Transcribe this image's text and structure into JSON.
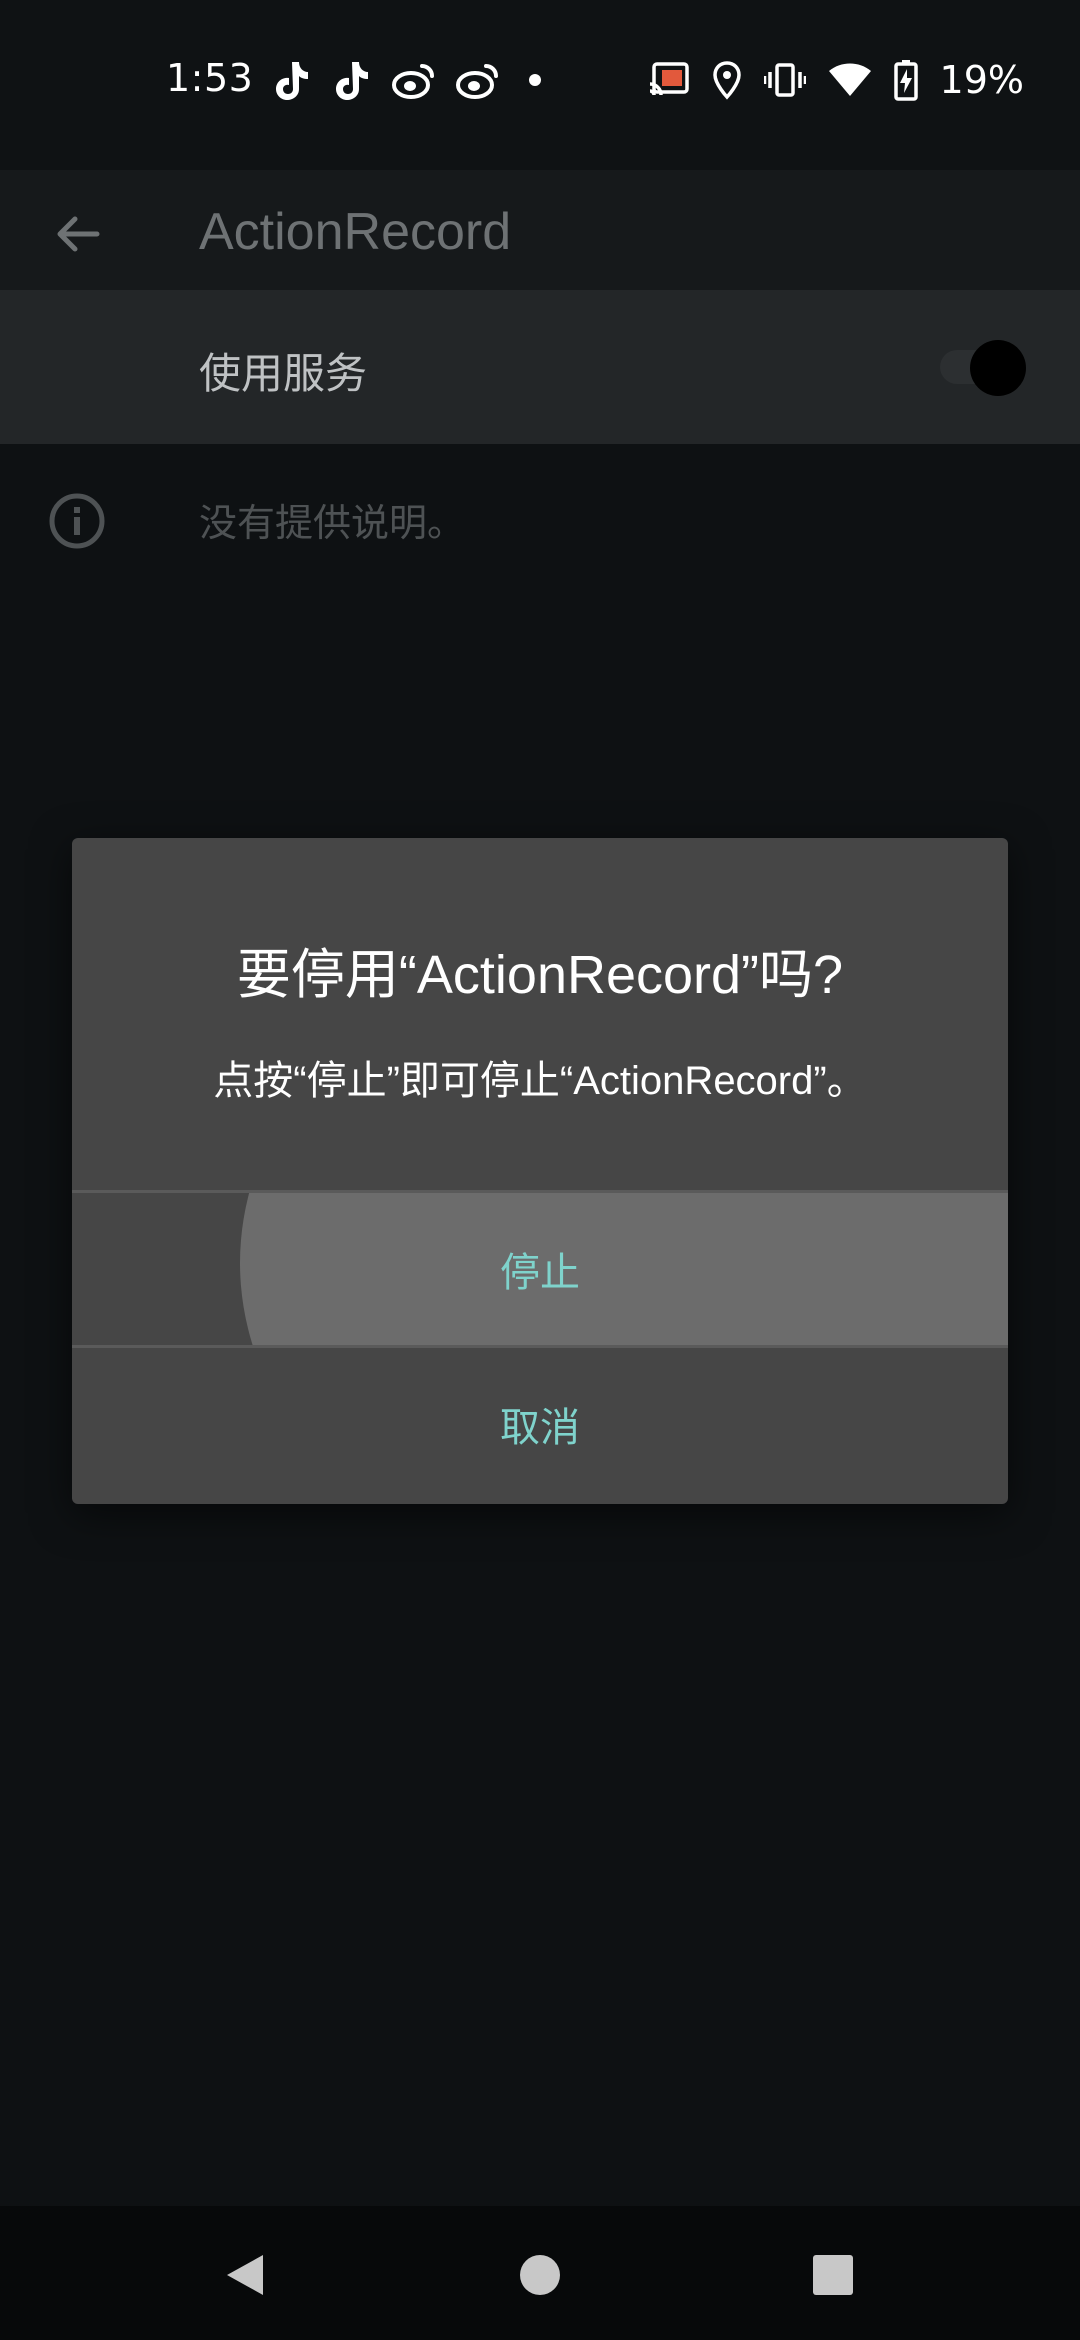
{
  "status_bar": {
    "time": "1:53",
    "battery_percent": "19%",
    "left_icons": [
      "tiktok-icon",
      "tiktok-icon",
      "weibo-icon",
      "weibo-icon",
      "notification-dot-icon"
    ],
    "right_icons": [
      "cast-icon",
      "location-icon",
      "vibrate-icon",
      "wifi-icon",
      "battery-charging-icon"
    ]
  },
  "app_bar": {
    "title": "ActionRecord",
    "back_icon": "arrow-back-icon"
  },
  "service_toggle": {
    "label": "使用服务",
    "enabled": true
  },
  "description": {
    "icon": "info-icon",
    "text": "没有提供说明。"
  },
  "dialog": {
    "title": "要停用“ActionRecord”吗?",
    "message": "点按“停止”即可停止“ActionRecord”。",
    "stop_label": "停止",
    "cancel_label": "取消",
    "accent_color": "#7fd3cc"
  },
  "nav_bar": {
    "icons": [
      "nav-back-icon",
      "nav-home-icon",
      "nav-recents-icon"
    ]
  }
}
